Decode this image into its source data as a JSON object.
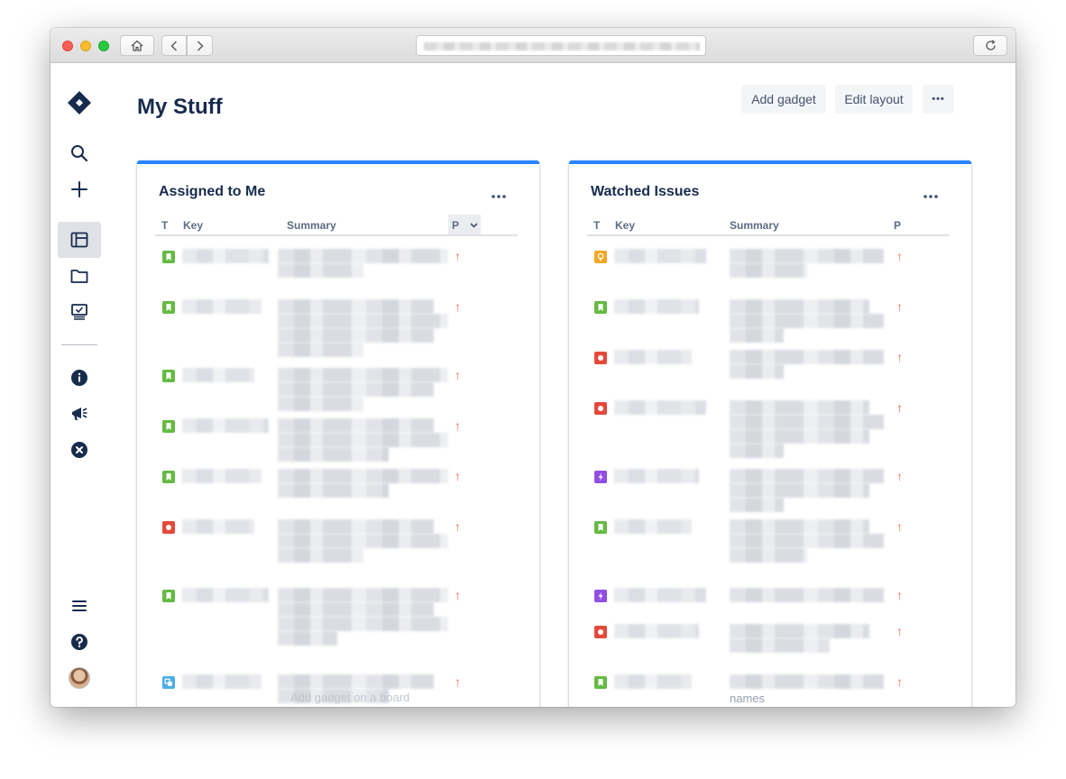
{
  "browser": {
    "home_icon": "home-icon",
    "back_icon": "chevron-left-icon",
    "forward_icon": "chevron-right-icon",
    "reload_icon": "reload-icon"
  },
  "sidebar": {
    "items": [
      "jira-logo",
      "search-icon",
      "plus-icon",
      "dashboard-icon",
      "folder-icon",
      "board-icon",
      "info-icon",
      "megaphone-icon",
      "close-circle-icon",
      "menu-icon",
      "help-icon",
      "avatar"
    ]
  },
  "header": {
    "title": "My Stuff",
    "add_gadget": "Add gadget",
    "edit_layout": "Edit layout",
    "more": "•••"
  },
  "colors": {
    "accent": "#2684FF",
    "title": "#172B4D",
    "story": "#65BA43",
    "bug": "#E5493A",
    "epic": "#904EE2",
    "improvement": "#F5A623",
    "subtask": "#4BADE8",
    "priority_high": "#FF7452",
    "priority_highest": "#FF5630"
  },
  "gadgets": [
    {
      "title": "Assigned to Me",
      "more": "•••",
      "columns": {
        "t": "T",
        "key": "Key",
        "summary": "Summary",
        "p": "P"
      },
      "footer": "Add gadget on a board",
      "rows": [
        {
          "type": "story",
          "priority": "high"
        },
        {
          "type": "story",
          "priority": "high"
        },
        {
          "type": "story",
          "priority": "high"
        },
        {
          "type": "story",
          "priority": "high"
        },
        {
          "type": "story",
          "priority": "high"
        },
        {
          "type": "bug",
          "priority": "high"
        },
        {
          "type": "story",
          "priority": "high"
        },
        {
          "type": "subtask",
          "priority": "high"
        }
      ]
    },
    {
      "title": "Watched Issues",
      "more": "•••",
      "columns": {
        "t": "T",
        "key": "Key",
        "summary": "Summary",
        "p": "P"
      },
      "footer": "names",
      "rows": [
        {
          "type": "improvement",
          "priority": "high"
        },
        {
          "type": "story",
          "priority": "high"
        },
        {
          "type": "bug",
          "priority": "high"
        },
        {
          "type": "bug",
          "priority": "highest"
        },
        {
          "type": "epic",
          "priority": "high"
        },
        {
          "type": "story",
          "priority": "high"
        },
        {
          "type": "epic",
          "priority": "high"
        },
        {
          "type": "bug",
          "priority": "high"
        },
        {
          "type": "story",
          "priority": "high"
        }
      ]
    }
  ]
}
